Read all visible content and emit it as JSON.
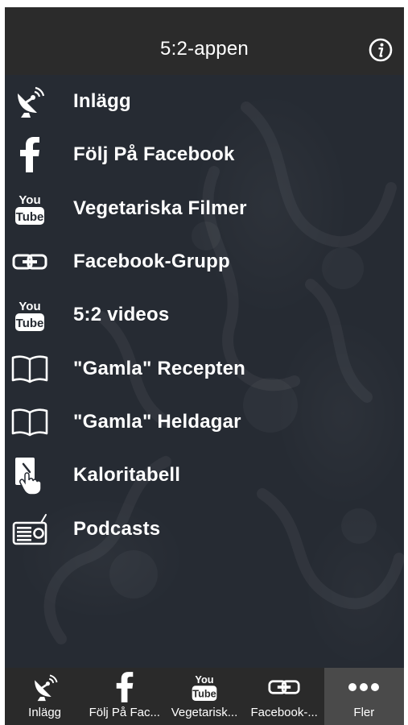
{
  "header": {
    "title": "5:2-appen",
    "info_icon": "info-circle-icon"
  },
  "menu": {
    "items": [
      {
        "label": "Inlägg",
        "icon": "satellite-dish-icon"
      },
      {
        "label": "Följ På Facebook",
        "icon": "facebook-icon"
      },
      {
        "label": "Vegetariska Filmer",
        "icon": "youtube-icon"
      },
      {
        "label": "Facebook-Grupp",
        "icon": "link-icon"
      },
      {
        "label": "5:2 videos",
        "icon": "youtube-icon"
      },
      {
        "label": "\"Gamla\" Recepten",
        "icon": "open-book-icon"
      },
      {
        "label": "\"Gamla\" Heldagar",
        "icon": "open-book-icon"
      },
      {
        "label": "Kaloritabell",
        "icon": "touch-tablet-icon"
      },
      {
        "label": "Podcasts",
        "icon": "radio-icon"
      }
    ]
  },
  "tabbar": {
    "tabs": [
      {
        "label": "Inlägg",
        "icon": "satellite-dish-icon",
        "active": false
      },
      {
        "label": "Följ På Fac...",
        "icon": "facebook-icon",
        "active": false
      },
      {
        "label": "Vegetarisk...",
        "icon": "youtube-icon",
        "active": false
      },
      {
        "label": "Facebook-...",
        "icon": "link-icon",
        "active": false
      },
      {
        "label": "Fler",
        "icon": "more-dots-icon",
        "active": true
      }
    ]
  },
  "colors": {
    "nav_bar": "#2b2b2b",
    "background": "#262b33",
    "tab_bar": "#2a2a2a",
    "active_tab": "#4a4a4a",
    "text": "#ffffff"
  }
}
